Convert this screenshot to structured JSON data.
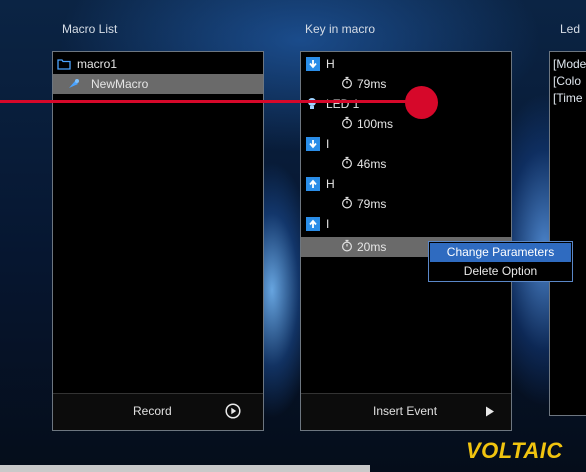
{
  "colors": {
    "accent": "#2a8de8",
    "annotation": "#d6082a",
    "logo": "#f1c40f",
    "selection": "#6a6a6a",
    "menu_highlight": "#2f6bc0"
  },
  "panels": {
    "macro_list": {
      "title": "Macro List",
      "items": [
        {
          "label": "macro1",
          "icon": "folder-icon"
        },
        {
          "label": "NewMacro",
          "icon": "macro-file-icon",
          "selected": true
        }
      ],
      "footer": {
        "label": "Record",
        "icon": "play-circle-icon"
      }
    },
    "key_in_macro": {
      "title": "Key in macro",
      "events": [
        {
          "type": "key-down",
          "label": "H",
          "icon": "arrow-down-icon"
        },
        {
          "type": "delay",
          "label": "79ms",
          "icon": "stopwatch-icon"
        },
        {
          "type": "led",
          "label": "LED 1",
          "icon": "bulb-icon"
        },
        {
          "type": "delay",
          "label": "100ms",
          "icon": "stopwatch-icon"
        },
        {
          "type": "key-down",
          "label": "I",
          "icon": "arrow-down-icon"
        },
        {
          "type": "delay",
          "label": "46ms",
          "icon": "stopwatch-icon"
        },
        {
          "type": "key-up",
          "label": "H",
          "icon": "arrow-up-icon"
        },
        {
          "type": "delay",
          "label": "79ms",
          "icon": "stopwatch-icon"
        },
        {
          "type": "key-up",
          "label": "I",
          "icon": "arrow-up-icon"
        },
        {
          "type": "delay",
          "label": "20ms",
          "icon": "stopwatch-icon",
          "selected": true
        }
      ],
      "footer": {
        "label": "Insert Event",
        "icon": "play-triangle-icon"
      }
    },
    "led": {
      "title": "Led",
      "lines": [
        "[Mode",
        "[Colo",
        "[Time"
      ]
    }
  },
  "context_menu": {
    "items": [
      "Change Parameters",
      "Delete Option"
    ]
  },
  "brand": {
    "logo_text": "VOLTAIC"
  }
}
